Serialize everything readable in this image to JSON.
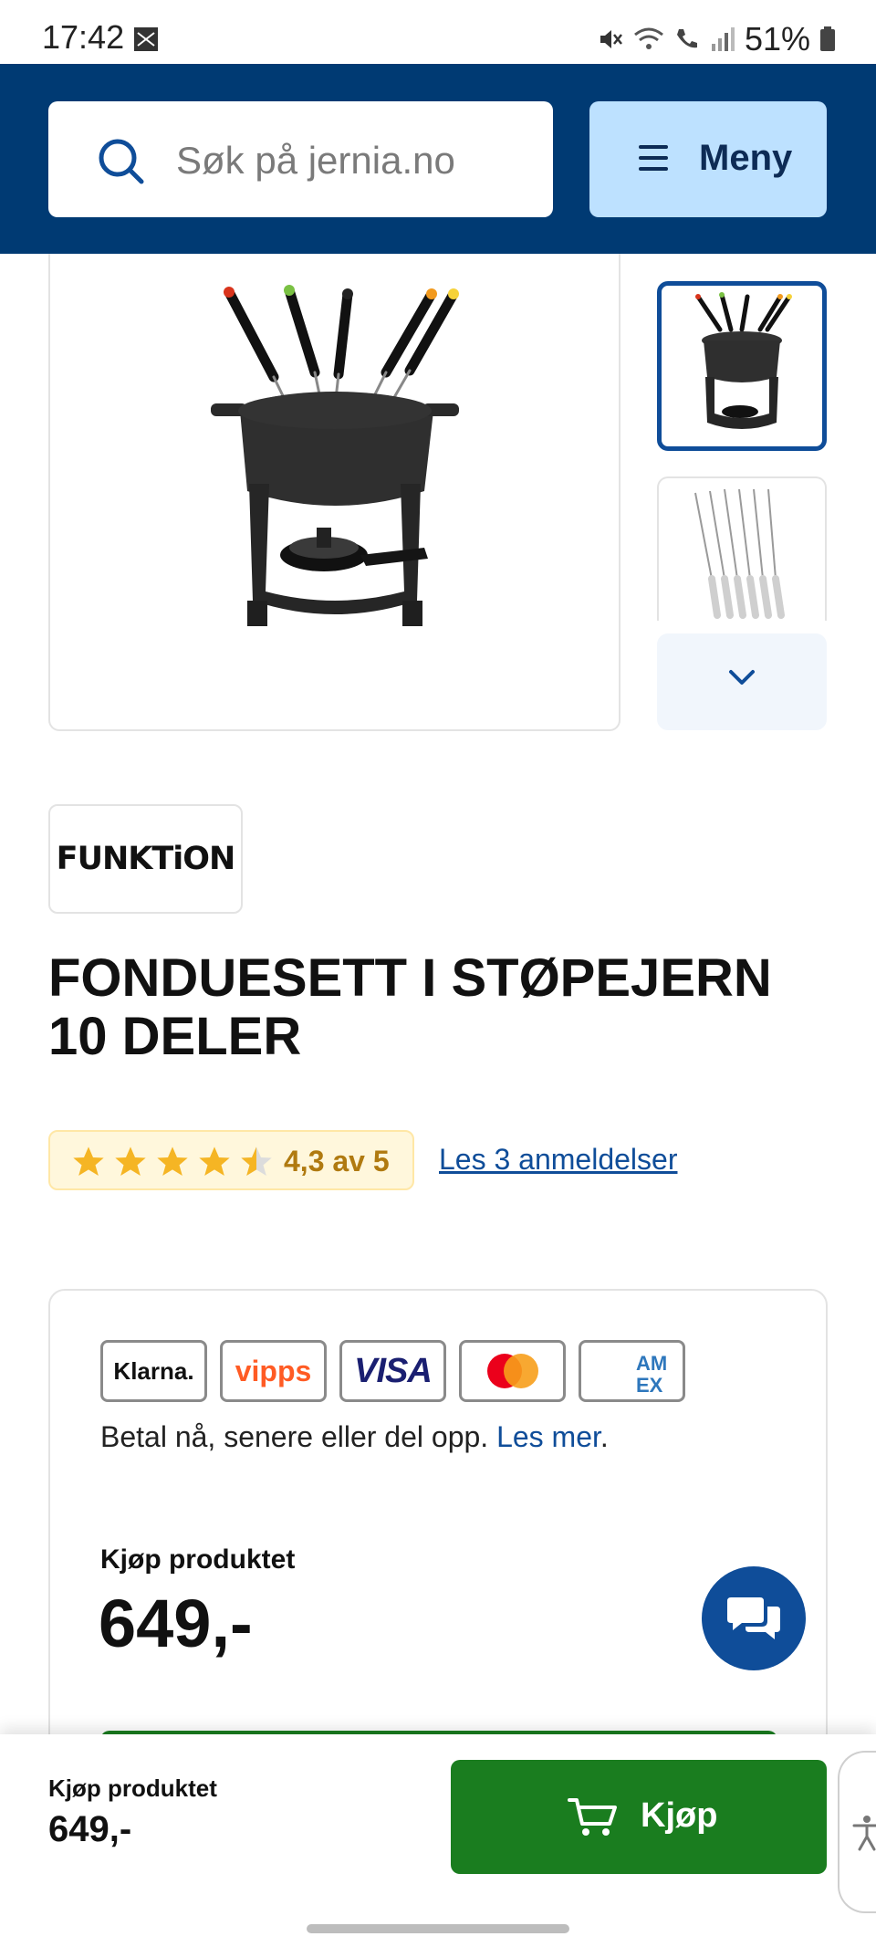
{
  "status_bar": {
    "time": "17:42",
    "battery": "51%"
  },
  "header": {
    "search_placeholder": "Søk på jernia.no",
    "menu_label": "Meny"
  },
  "gallery": {
    "main_image": "fondue-set-cast-iron",
    "thumbnails": [
      "fondue-set-cast-iron",
      "fondue-forks"
    ]
  },
  "product": {
    "brand": "FUNKTiON",
    "title": "FONDUESETT I STØPEJERN 10 DELER",
    "rating_value": 4.3,
    "rating_text": "4,3 av 5",
    "reviews_link": "Les 3 anmeldelser"
  },
  "buy_card": {
    "payment_methods": [
      "Klarna.",
      "vipps",
      "VISA",
      "Mastercard",
      "AMEX"
    ],
    "payment_note": "Betal nå, senere eller del opp.",
    "payment_note_link": "Les mer",
    "payment_note_end": ".",
    "buy_label": "Kjøp produktet",
    "price": "649,-"
  },
  "sticky_bar": {
    "buy_label": "Kjøp produktet",
    "price": "649,-",
    "button_label": "Kjøp"
  },
  "colors": {
    "header_bg": "#003a73",
    "menu_bg": "#bde1ff",
    "buy_green": "#1a7d1f",
    "link_blue": "#0f4d99",
    "rating_bg": "#fff7dc",
    "star": "#f5b524"
  }
}
